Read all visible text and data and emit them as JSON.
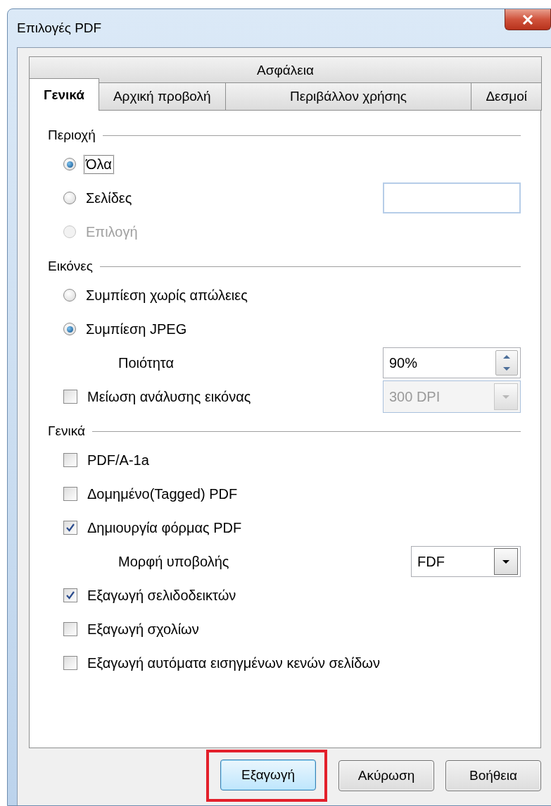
{
  "window": {
    "title": "Επιλογές PDF"
  },
  "tab_rows": [
    [
      {
        "label": "Ασφάλεια",
        "selected": false
      }
    ],
    [
      {
        "label": "Γενικά",
        "selected": true
      },
      {
        "label": "Αρχική προβολή",
        "selected": false
      },
      {
        "label": "Περιβάλλον χρήσης",
        "selected": false
      },
      {
        "label": "Δεσμοί",
        "selected": false
      }
    ]
  ],
  "sections": [
    {
      "title": "Περιοχή",
      "items": [
        {
          "kind": "radio",
          "label": "Όλα",
          "selected": true,
          "disabled": false,
          "focused": true
        },
        {
          "kind": "radio_field",
          "label": "Σελίδες",
          "selected": false,
          "disabled": false,
          "focused": false
        },
        {
          "kind": "radio",
          "label": "Επιλογή",
          "selected": false,
          "disabled": true,
          "focused": false
        }
      ]
    },
    {
      "title": "Εικόνες",
      "items": [
        {
          "kind": "radio",
          "label": "Συμπίεση χωρίς απώλειες",
          "selected": false,
          "disabled": false,
          "focused": false
        },
        {
          "kind": "radio",
          "label": "Συμπίεση JPEG",
          "selected": true,
          "disabled": false,
          "focused": false
        },
        {
          "kind": "spin",
          "label": "Ποιότητα",
          "value": "90%"
        },
        {
          "kind": "checkbox_combo",
          "label": "Μείωση ανάλυσης εικόνας",
          "checked": false,
          "value": "300 DPI",
          "combo_disabled": true
        }
      ]
    },
    {
      "title": "Γενικά",
      "items": [
        {
          "kind": "checkbox",
          "label": "PDF/A-1a",
          "checked": false
        },
        {
          "kind": "checkbox",
          "label": "Δομημένο(Tagged) PDF",
          "checked": false
        },
        {
          "kind": "checkbox",
          "label": "Δημιουργία φόρμας PDF",
          "checked": true
        },
        {
          "kind": "combo",
          "label": "Μορφή υποβολής",
          "value": "FDF",
          "combo_disabled": false
        },
        {
          "kind": "checkbox",
          "label": "Εξαγωγή σελιδοδεικτών",
          "checked": true
        },
        {
          "kind": "checkbox",
          "label": "Εξαγωγή σχολίων",
          "checked": false
        },
        {
          "kind": "checkbox",
          "label": "Εξαγωγή αυτόματα εισηγμένων κενών σελίδων",
          "checked": false
        }
      ]
    }
  ],
  "buttons": [
    {
      "label": "Εξαγωγή",
      "default": true,
      "highlighted": true
    },
    {
      "label": "Ακύρωση",
      "default": false,
      "highlighted": false
    },
    {
      "label": "Βοήθεια",
      "default": false,
      "highlighted": false
    }
  ]
}
